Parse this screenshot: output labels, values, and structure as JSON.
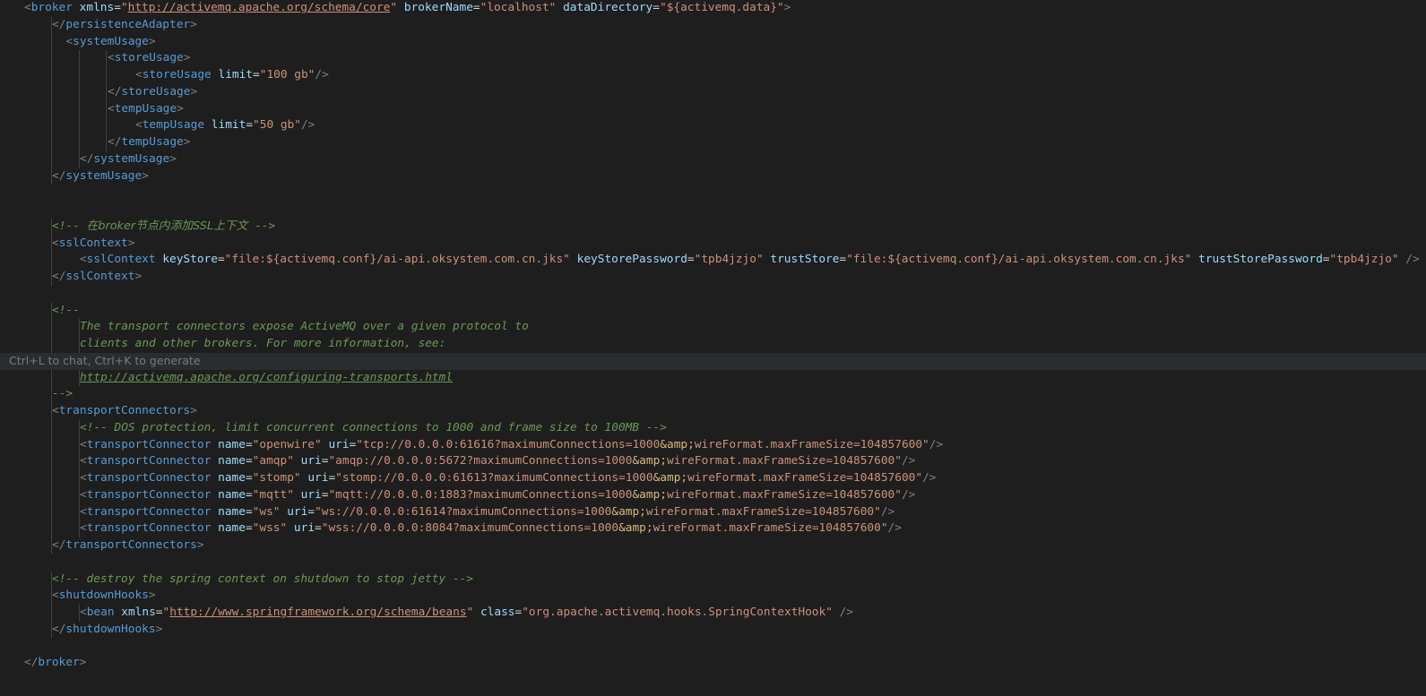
{
  "editor": {
    "theme_colors": {
      "background": "#1e1e1e",
      "tag": "#569cd6",
      "attribute": "#9cdcfe",
      "string": "#ce9178",
      "comment": "#6a9955",
      "punctuation": "#808080"
    },
    "inline_hint": "Ctrl+L to chat, Ctrl+K to generate",
    "lines": [
      {
        "indent": 1,
        "tokens": [
          [
            "p",
            "<"
          ],
          [
            "t",
            "broker"
          ],
          [
            "e",
            " "
          ],
          [
            "a",
            "xmlns"
          ],
          [
            "e",
            "="
          ],
          [
            "v",
            "\""
          ],
          [
            "u",
            "http://activemq.apache.org/schema/core"
          ],
          [
            "v",
            "\""
          ],
          [
            "e",
            " "
          ],
          [
            "a",
            "brokerName"
          ],
          [
            "e",
            "="
          ],
          [
            "v",
            "\"localhost\""
          ],
          [
            "e",
            " "
          ],
          [
            "a",
            "dataDirectory"
          ],
          [
            "e",
            "="
          ],
          [
            "v",
            "\"${activemq.data}\""
          ],
          [
            "p",
            ">"
          ]
        ]
      },
      {
        "indent": 2,
        "tokens": [
          [
            "p",
            "</"
          ],
          [
            "t",
            "persistenceAdapter"
          ],
          [
            "p",
            ">"
          ]
        ]
      },
      {
        "indent": 2,
        "tokens": [
          [
            "e",
            "  "
          ],
          [
            "p",
            "<"
          ],
          [
            "t",
            "systemUsage"
          ],
          [
            "p",
            ">"
          ]
        ]
      },
      {
        "indent": 4,
        "tokens": [
          [
            "p",
            "<"
          ],
          [
            "t",
            "storeUsage"
          ],
          [
            "p",
            ">"
          ]
        ]
      },
      {
        "indent": 5,
        "tokens": [
          [
            "p",
            "<"
          ],
          [
            "t",
            "storeUsage"
          ],
          [
            "e",
            " "
          ],
          [
            "a",
            "limit"
          ],
          [
            "e",
            "="
          ],
          [
            "v",
            "\"100 gb\""
          ],
          [
            "p",
            "/>"
          ]
        ]
      },
      {
        "indent": 4,
        "tokens": [
          [
            "p",
            "</"
          ],
          [
            "t",
            "storeUsage"
          ],
          [
            "p",
            ">"
          ]
        ]
      },
      {
        "indent": 4,
        "tokens": [
          [
            "p",
            "<"
          ],
          [
            "t",
            "tempUsage"
          ],
          [
            "p",
            ">"
          ]
        ]
      },
      {
        "indent": 5,
        "tokens": [
          [
            "p",
            "<"
          ],
          [
            "t",
            "tempUsage"
          ],
          [
            "e",
            " "
          ],
          [
            "a",
            "limit"
          ],
          [
            "e",
            "="
          ],
          [
            "v",
            "\"50 gb\""
          ],
          [
            "p",
            "/>"
          ]
        ]
      },
      {
        "indent": 4,
        "tokens": [
          [
            "p",
            "</"
          ],
          [
            "t",
            "tempUsage"
          ],
          [
            "p",
            ">"
          ]
        ]
      },
      {
        "indent": 3,
        "tokens": [
          [
            "p",
            "</"
          ],
          [
            "t",
            "systemUsage"
          ],
          [
            "p",
            ">"
          ]
        ]
      },
      {
        "indent": 2,
        "tokens": [
          [
            "p",
            "</"
          ],
          [
            "t",
            "systemUsage"
          ],
          [
            "p",
            ">"
          ]
        ]
      },
      {
        "indent": 0,
        "tokens": []
      },
      {
        "indent": 0,
        "tokens": []
      },
      {
        "indent": 2,
        "tokens": [
          [
            "c",
            "<!-- "
          ],
          [
            "cz",
            "在broker节点内添加SSL上下文"
          ],
          [
            "c",
            " -->"
          ]
        ]
      },
      {
        "indent": 2,
        "tokens": [
          [
            "p",
            "<"
          ],
          [
            "t",
            "sslContext"
          ],
          [
            "p",
            ">"
          ]
        ]
      },
      {
        "indent": 2,
        "tokens": [
          [
            "e",
            "    "
          ],
          [
            "p",
            "<"
          ],
          [
            "t",
            "sslContext"
          ],
          [
            "e",
            " "
          ],
          [
            "a",
            "keyStore"
          ],
          [
            "e",
            "="
          ],
          [
            "v",
            "\"file:${activemq.conf}/ai-api.oksystem.com.cn.jks\""
          ],
          [
            "e",
            " "
          ],
          [
            "a",
            "keyStorePassword"
          ],
          [
            "e",
            "="
          ],
          [
            "v",
            "\"tpb4jzjo\""
          ],
          [
            "e",
            " "
          ],
          [
            "a",
            "trustStore"
          ],
          [
            "e",
            "="
          ],
          [
            "v",
            "\"file:${activemq.conf}/ai-api.oksystem.com.cn.jks\""
          ],
          [
            "e",
            " "
          ],
          [
            "a",
            "trustStorePassword"
          ],
          [
            "e",
            "="
          ],
          [
            "v",
            "\"tpb4jzjo\""
          ],
          [
            "e",
            " "
          ],
          [
            "p",
            "/>"
          ]
        ]
      },
      {
        "indent": 2,
        "tokens": [
          [
            "p",
            "</"
          ],
          [
            "t",
            "sslContext"
          ],
          [
            "p",
            ">"
          ]
        ]
      },
      {
        "indent": 0,
        "tokens": []
      },
      {
        "indent": 2,
        "tokens": [
          [
            "c",
            "<!--"
          ]
        ]
      },
      {
        "indent": 3,
        "tokens": [
          [
            "c",
            "The transport connectors expose ActiveMQ over a given protocol to"
          ]
        ]
      },
      {
        "indent": 3,
        "tokens": [
          [
            "c",
            "clients and other brokers. For more information, see:"
          ]
        ]
      },
      {
        "indent": 0,
        "hint": true,
        "tokens": []
      },
      {
        "indent": 3,
        "tokens": [
          [
            "cu",
            "http://activemq.apache.org/configuring-transports.html"
          ]
        ]
      },
      {
        "indent": 2,
        "tokens": [
          [
            "c",
            "-->"
          ]
        ]
      },
      {
        "indent": 2,
        "tokens": [
          [
            "p",
            "<"
          ],
          [
            "t",
            "transportConnectors"
          ],
          [
            "p",
            ">"
          ]
        ]
      },
      {
        "indent": 3,
        "tokens": [
          [
            "c",
            "<!-- DOS protection, limit concurrent connections to 1000 and frame size to 100MB -->"
          ]
        ]
      },
      {
        "indent": 3,
        "tokens": [
          [
            "p",
            "<"
          ],
          [
            "t",
            "transportConnector"
          ],
          [
            "e",
            " "
          ],
          [
            "a",
            "name"
          ],
          [
            "e",
            "="
          ],
          [
            "v",
            "\"openwire\""
          ],
          [
            "e",
            " "
          ],
          [
            "a",
            "uri"
          ],
          [
            "e",
            "="
          ],
          [
            "v",
            "\"tcp://0.0.0.0:61616?maximumConnections=1000"
          ],
          [
            "ent",
            "&amp;"
          ],
          [
            "v",
            "wireFormat.maxFrameSize=104857600\""
          ],
          [
            "p",
            "/>"
          ]
        ]
      },
      {
        "indent": 3,
        "tokens": [
          [
            "p",
            "<"
          ],
          [
            "t",
            "transportConnector"
          ],
          [
            "e",
            " "
          ],
          [
            "a",
            "name"
          ],
          [
            "e",
            "="
          ],
          [
            "v",
            "\"amqp\""
          ],
          [
            "e",
            " "
          ],
          [
            "a",
            "uri"
          ],
          [
            "e",
            "="
          ],
          [
            "v",
            "\"amqp://0.0.0.0:5672?maximumConnections=1000"
          ],
          [
            "ent",
            "&amp;"
          ],
          [
            "v",
            "wireFormat.maxFrameSize=104857600\""
          ],
          [
            "p",
            "/>"
          ]
        ]
      },
      {
        "indent": 3,
        "tokens": [
          [
            "p",
            "<"
          ],
          [
            "t",
            "transportConnector"
          ],
          [
            "e",
            " "
          ],
          [
            "a",
            "name"
          ],
          [
            "e",
            "="
          ],
          [
            "v",
            "\"stomp\""
          ],
          [
            "e",
            " "
          ],
          [
            "a",
            "uri"
          ],
          [
            "e",
            "="
          ],
          [
            "v",
            "\"stomp://0.0.0.0:61613?maximumConnections=1000"
          ],
          [
            "ent",
            "&amp;"
          ],
          [
            "v",
            "wireFormat.maxFrameSize=104857600\""
          ],
          [
            "p",
            "/>"
          ]
        ]
      },
      {
        "indent": 3,
        "tokens": [
          [
            "p",
            "<"
          ],
          [
            "t",
            "transportConnector"
          ],
          [
            "e",
            " "
          ],
          [
            "a",
            "name"
          ],
          [
            "e",
            "="
          ],
          [
            "v",
            "\"mqtt\""
          ],
          [
            "e",
            " "
          ],
          [
            "a",
            "uri"
          ],
          [
            "e",
            "="
          ],
          [
            "v",
            "\"mqtt://0.0.0.0:1883?maximumConnections=1000"
          ],
          [
            "ent",
            "&amp;"
          ],
          [
            "v",
            "wireFormat.maxFrameSize=104857600\""
          ],
          [
            "p",
            "/>"
          ]
        ]
      },
      {
        "indent": 3,
        "tokens": [
          [
            "p",
            "<"
          ],
          [
            "t",
            "transportConnector"
          ],
          [
            "e",
            " "
          ],
          [
            "a",
            "name"
          ],
          [
            "e",
            "="
          ],
          [
            "v",
            "\"ws\""
          ],
          [
            "e",
            " "
          ],
          [
            "a",
            "uri"
          ],
          [
            "e",
            "="
          ],
          [
            "v",
            "\"ws://0.0.0.0:61614?maximumConnections=1000"
          ],
          [
            "ent",
            "&amp;"
          ],
          [
            "v",
            "wireFormat.maxFrameSize=104857600\""
          ],
          [
            "p",
            "/>"
          ]
        ]
      },
      {
        "indent": 3,
        "tokens": [
          [
            "p",
            "<"
          ],
          [
            "t",
            "transportConnector"
          ],
          [
            "e",
            " "
          ],
          [
            "a",
            "name"
          ],
          [
            "e",
            "="
          ],
          [
            "v",
            "\"wss\""
          ],
          [
            "e",
            " "
          ],
          [
            "a",
            "uri"
          ],
          [
            "e",
            "="
          ],
          [
            "v",
            "\"wss://0.0.0.0:8084?maximumConnections=1000"
          ],
          [
            "ent",
            "&amp;"
          ],
          [
            "v",
            "wireFormat.maxFrameSize=104857600\""
          ],
          [
            "p",
            "/>"
          ]
        ]
      },
      {
        "indent": 2,
        "tokens": [
          [
            "p",
            "</"
          ],
          [
            "t",
            "transportConnectors"
          ],
          [
            "p",
            ">"
          ]
        ]
      },
      {
        "indent": 0,
        "tokens": []
      },
      {
        "indent": 2,
        "tokens": [
          [
            "c",
            "<!-- destroy the spring context on shutdown to stop jetty -->"
          ]
        ]
      },
      {
        "indent": 2,
        "tokens": [
          [
            "p",
            "<"
          ],
          [
            "t",
            "shutdownHooks"
          ],
          [
            "p",
            ">"
          ]
        ]
      },
      {
        "indent": 3,
        "tokens": [
          [
            "p",
            "<"
          ],
          [
            "t",
            "bean"
          ],
          [
            "e",
            " "
          ],
          [
            "a",
            "xmlns"
          ],
          [
            "e",
            "="
          ],
          [
            "v",
            "\""
          ],
          [
            "u",
            "http://www.springframework.org/schema/beans"
          ],
          [
            "v",
            "\""
          ],
          [
            "e",
            " "
          ],
          [
            "a",
            "class"
          ],
          [
            "e",
            "="
          ],
          [
            "v",
            "\"org.apache.activemq.hooks.SpringContextHook\""
          ],
          [
            "e",
            " "
          ],
          [
            "p",
            "/>"
          ]
        ]
      },
      {
        "indent": 2,
        "tokens": [
          [
            "p",
            "</"
          ],
          [
            "t",
            "shutdownHooks"
          ],
          [
            "p",
            ">"
          ]
        ]
      },
      {
        "indent": 0,
        "tokens": []
      },
      {
        "indent": 1,
        "tokens": [
          [
            "p",
            "</"
          ],
          [
            "t",
            "broker"
          ],
          [
            "p",
            ">"
          ]
        ]
      }
    ]
  }
}
